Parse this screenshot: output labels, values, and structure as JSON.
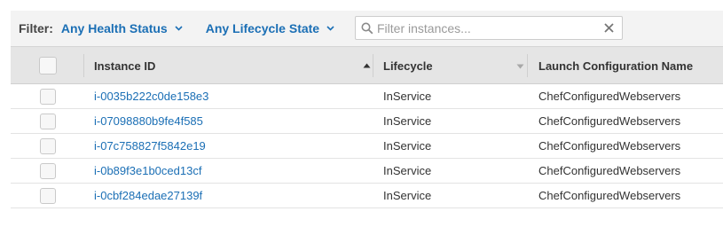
{
  "filter_bar": {
    "label": "Filter:",
    "health_status": "Any Health Status",
    "lifecycle_state": "Any Lifecycle State",
    "search_placeholder": "Filter instances...",
    "search_value": ""
  },
  "table": {
    "columns": {
      "instance_id": "Instance ID",
      "lifecycle": "Lifecycle",
      "launch_config": "Launch Configuration Name"
    },
    "sort": {
      "column": "Instance ID",
      "direction": "ascending"
    },
    "rows": [
      {
        "instance_id": "i-0035b222c0de158e3",
        "lifecycle": "InService",
        "launch_config": "ChefConfiguredWebservers"
      },
      {
        "instance_id": "i-07098880b9fe4f585",
        "lifecycle": "InService",
        "launch_config": "ChefConfiguredWebservers"
      },
      {
        "instance_id": "i-07c758827f5842e19",
        "lifecycle": "InService",
        "launch_config": "ChefConfiguredWebservers"
      },
      {
        "instance_id": "i-0b89f3e1b0ced13cf",
        "lifecycle": "InService",
        "launch_config": "ChefConfiguredWebservers"
      },
      {
        "instance_id": "i-0cbf284edae27139f",
        "lifecycle": "InService",
        "launch_config": "ChefConfiguredWebservers"
      }
    ]
  },
  "colors": {
    "link": "#1b6fb5",
    "header_bg": "#e5e5e5",
    "filter_bar_bg": "#f3f3f3"
  },
  "icons": {
    "dropdown": "chevron-down-icon",
    "search": "search-icon",
    "clear": "close-icon",
    "sort_active": "sort-ascending-icon",
    "sort_inactive": "sort-descending-icon"
  }
}
